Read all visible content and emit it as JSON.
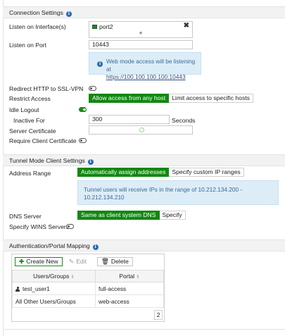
{
  "connection_settings": {
    "header": "Connection Settings",
    "listen_interface_label": "Listen on Interface(s)",
    "interface_tag": "port2",
    "add_symbol": "+",
    "remove_symbol": "✖",
    "listen_port_label": "Listen on Port",
    "listen_port_value": "10443",
    "port_note_text": "Web mode access will be listening at",
    "port_note_link": "https://100.100.100.100:10443",
    "redirect_label": "Redirect HTTP to SSL-VPN",
    "redirect_enabled": false,
    "restrict_access_label": "Restrict Access",
    "restrict_options": [
      "Allow access from any host",
      "Limit access to specific hosts"
    ],
    "restrict_selected": "Allow access from any host",
    "idle_logout_label": "Idle Logout",
    "idle_logout_enabled": true,
    "inactive_for_label": "Inactive For",
    "inactive_for_value": "300",
    "inactive_for_unit": "Seconds",
    "server_certificate_label": "Server Certificate",
    "require_client_cert_label": "Require Client Certificate",
    "require_client_cert_enabled": false
  },
  "tunnel_settings": {
    "header": "Tunnel Mode Client Settings",
    "address_range_label": "Address Range",
    "address_options": [
      "Automatically assign addresses",
      "Specify custom IP ranges"
    ],
    "address_selected": "Automatically assign addresses",
    "range_note": "Tunnel users will receive IPs in the range of 10.212.134.200 - 10.212.134.210",
    "dns_server_label": "DNS Server",
    "dns_options": [
      "Same as client system DNS",
      "Specify"
    ],
    "dns_selected": "Same as client system DNS",
    "wins_label": "Specify WINS Servers",
    "wins_enabled": false
  },
  "auth_mapping": {
    "header": "Authentication/Portal Mapping",
    "toolbar": {
      "create_label": "Create New",
      "edit_label": "Edit",
      "delete_label": "Delete"
    },
    "columns": [
      "Users/Groups",
      "Portal"
    ],
    "rows": [
      {
        "user": "test_user1",
        "portal": "full-access",
        "user_icon": "user-icon"
      },
      {
        "user": "All Other Users/Groups",
        "portal": "web-access",
        "user_icon": ""
      }
    ],
    "count": "2"
  },
  "colors": {
    "accent_green": "#118811",
    "info_blue": "#2a6bb0",
    "note_bg": "#dcedf8"
  }
}
